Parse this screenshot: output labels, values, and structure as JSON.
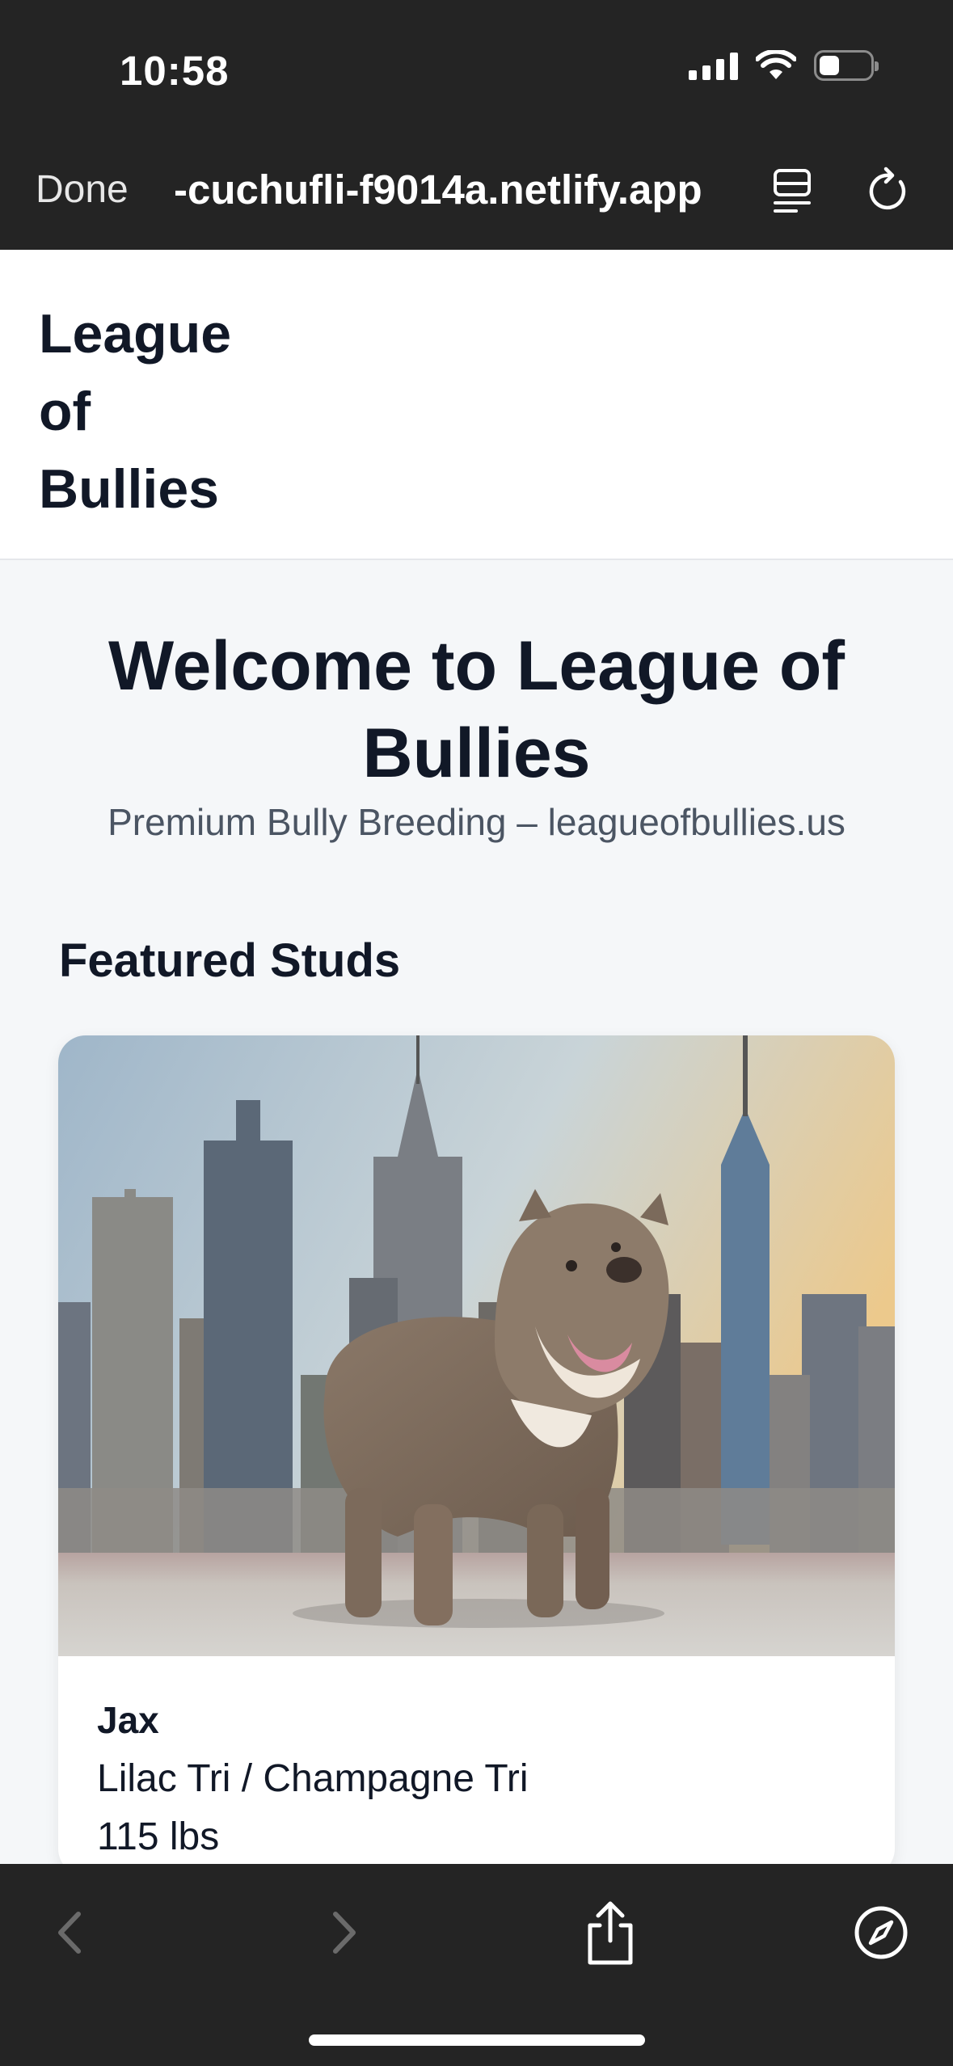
{
  "status_bar": {
    "time": "10:58"
  },
  "browser": {
    "done_label": "Done",
    "url": "-cuchufli-f9014a.netlify.app"
  },
  "site": {
    "brand_line1": "League",
    "brand_line2": "of",
    "brand_line3": "Bullies"
  },
  "hero": {
    "title": "Welcome to League of Bullies",
    "subtitle": "Premium Bully Breeding – leagueofbullies.us"
  },
  "featured": {
    "section_title": "Featured Studs",
    "studs": [
      {
        "name": "Jax",
        "colors": "Lilac Tri / Champagne Tri",
        "weight": "115 lbs"
      }
    ]
  },
  "toolbar": {
    "icons": [
      "back-icon",
      "forward-icon",
      "share-icon",
      "compass-icon"
    ]
  },
  "colors": {
    "chrome": "#242424",
    "page_bg": "#f5f7f9",
    "text_dark": "#111827",
    "text_muted": "#4b5563"
  }
}
